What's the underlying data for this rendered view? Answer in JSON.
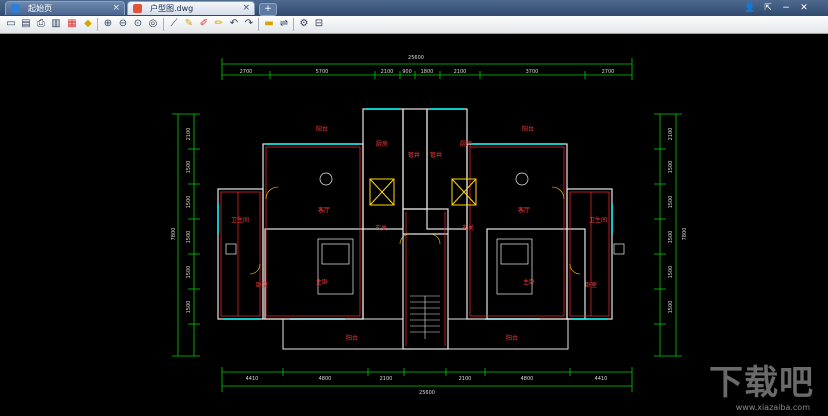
{
  "tabs": [
    {
      "label": "起始页",
      "close": "×"
    },
    {
      "label": "户型图.dwg",
      "close": "×"
    }
  ],
  "new_tab": "+",
  "window_controls": {
    "user": "👤",
    "fullscreen": "⇱",
    "minimize": "−",
    "close": "✕"
  },
  "toolbar_icons": [
    "open-icon",
    "save-icon",
    "print-icon",
    "saveas-icon",
    "layers-icon",
    "pan-icon",
    "zoom-window-icon",
    "zoom-extent-icon",
    "zoom-realtime-icon",
    "measure-icon",
    "pen-icon",
    "pencil-icon",
    "undo-icon",
    "redo-icon",
    "text-icon",
    "line-icon",
    "settings-icon",
    "color-icon",
    "switch-icon"
  ],
  "colors": {
    "background": "#000000",
    "wall": "#e8e8e8",
    "dimension": "#00e000",
    "room_label": "#ff3b3b",
    "window": "#00ffff",
    "door": "#ffff00"
  },
  "drawing": {
    "total_top": "25600",
    "total_bottom": "25600",
    "top_dims": [
      "2700",
      "5700",
      "2100",
      "900",
      "1800",
      "2100",
      "3700",
      "2700"
    ],
    "bottom_dims": [
      "4410",
      "4800",
      "2100",
      "2100",
      "4800",
      "4410"
    ],
    "left_dims": [
      "2100",
      "1500",
      "1500",
      "1500",
      "1500",
      "1500"
    ],
    "right_dims": [
      "2100",
      "1500",
      "1500",
      "1500",
      "1500",
      "1500"
    ],
    "left_total": "7800",
    "right_total": "7800",
    "room_labels": {
      "balcony_tl": "阳台",
      "kitchen_l": "厨房",
      "living_l": "客厅",
      "bath_l": "卫生间",
      "bedroom_l": "卧室",
      "master_bed_l": "主卧",
      "entry_l": "玄关",
      "balcony_bl": "阳台",
      "balcony_tr": "阳台",
      "kitchen_r": "厨房",
      "living_r": "客厅",
      "bath_r": "卫生间",
      "bedroom_r": "卧室",
      "master_bed_r": "主卧",
      "entry_r": "玄关",
      "balcony_br": "阳台",
      "shaft_1": "管井",
      "shaft_2": "管井"
    }
  },
  "watermark": {
    "main": "下载吧",
    "url": "www.xiazaiba.com"
  }
}
